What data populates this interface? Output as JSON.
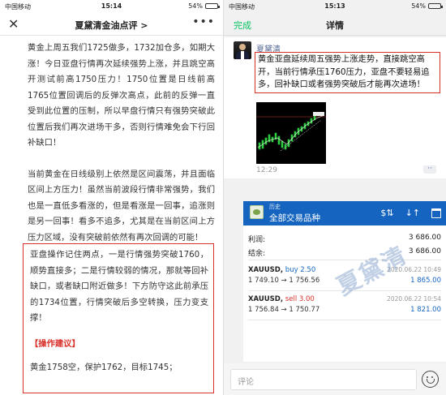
{
  "left": {
    "status": {
      "carrier": "中国移动",
      "time": "15:14",
      "battery": "54%",
      "battery_level": 0.54
    },
    "header": {
      "title": "夏黛清金油点评 >",
      "close_icon": "close-icon",
      "more_icon": "more-icon"
    },
    "paragraphs": [
      "黄金上周五我们1725做多，1732加仓多，如期大涨！今日亚盘行情再次延续强势上涨，并且跳空高开测试前高1750压力！1750位置是日线前高1765位置回调后的反弹次高点，此前的反弹一直受到此位置的压制，所以早盘行情只有强势突破此位置后我们再次进场干多，否则行情难免会下行回补缺口！",
      "当前黄金在日线级别上依然是区间震荡，并且面临区间上方压力！虽然当前波段行情非常强势，我们也是一直低多看涨的，但是看涨是一回事，追涨则是另一回事！看多不追多，尤其是在当前区间上方压力区域，没有突破前依然有再次回调的可能！"
    ],
    "box": {
      "body": "亚盘操作记住两点，一是行情强势突破1760，顺势直接多；二是行情较弱的情况，那就等回补缺口，或者缺口附近做多！下方防守这此前承压的1734位置，行情突破后多空转换，压力变支撑！",
      "tip": "【操作建议】",
      "plan": "黄金1758空，保护1762，目标1745；"
    }
  },
  "right": {
    "status": {
      "carrier": "中国移动",
      "time": "15:13",
      "battery": "54%",
      "battery_level": 0.54
    },
    "header": {
      "done": "完成",
      "title": "详情"
    },
    "post": {
      "author": "夏黛清",
      "text": "黄金亚盘延续周五强势上涨走势，直接跳空高开，当前行情承压1760压力，亚盘不要轻易追多，回补缺口或者强势突破后才能再次进场！",
      "time": "12:29",
      "more": "··"
    },
    "app": {
      "sub_title": "历史",
      "main_title": "全部交易品种",
      "profit_label": "利润:",
      "profit_value": "3 686.00",
      "balance_label": "结余:",
      "balance_value": "3 686.00",
      "trades": [
        {
          "symbol": "XAUUSD,",
          "side": "buy 2.50",
          "side_color": "#1565c0",
          "prices": "1 749.10 → 1 756.56",
          "date": "2020.06.22 10:49",
          "pnl": "1 865.00"
        },
        {
          "symbol": "XAUUSD,",
          "side": "sell 3.00",
          "side_color": "#d9302a",
          "prices": "1 756.84 → 1 750.77",
          "date": "2020.06.22 10:54",
          "pnl": "1 821.00"
        }
      ]
    },
    "watermark": "夏黛清",
    "input_placeholder": "评论"
  }
}
